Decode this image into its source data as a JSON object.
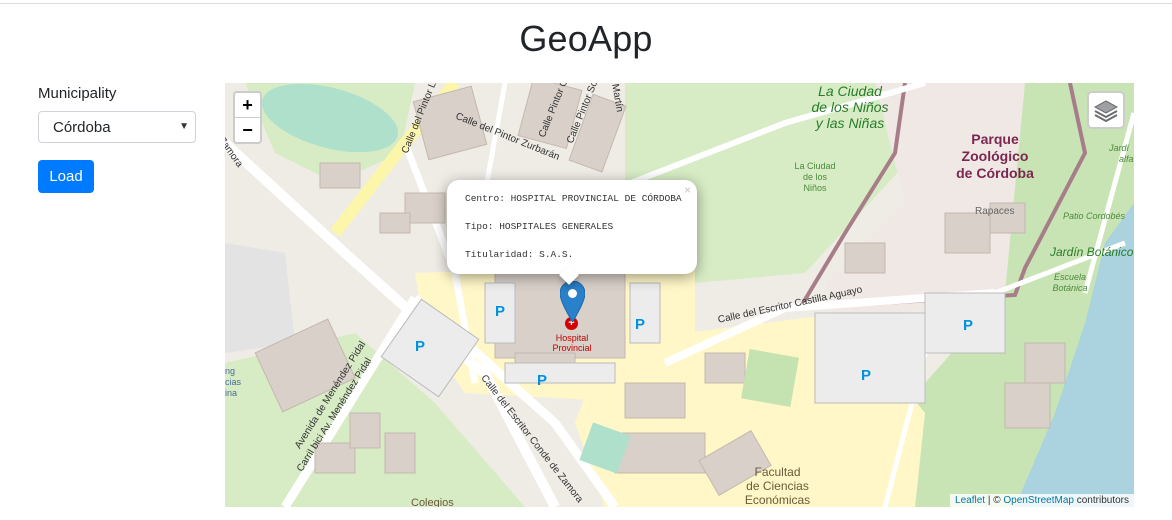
{
  "app": {
    "title": "GeoApp"
  },
  "sidebar": {
    "municipality_label": "Municipality",
    "municipality_value": "Córdoba",
    "load_label": "Load"
  },
  "map": {
    "controls": {
      "zoom_in": "+",
      "zoom_out": "−",
      "layers_icon": "layers-icon"
    },
    "popup": {
      "centro": "Centro: HOSPITAL PROVINCIAL DE CÓRDOBA",
      "tipo": "Tipo: HOSPITALES GENERALES",
      "titularidad": "Titularidad: S.A.S.",
      "close": "×"
    },
    "marker_icon": "map-pin-icon",
    "labels": {
      "parque1": "Parque",
      "parque2": "Zoológico",
      "parque3": "de Córdoba",
      "ciudad1": "La Ciudad",
      "ciudad2": "de los Niños",
      "ciudad3": "y las Niñas",
      "ciudad_small1": "La Ciudad",
      "ciudad_small2": "de los",
      "ciudad_small3": "Niños",
      "rapaces": "Rapaces",
      "patio": "Patio Cordobés",
      "jardin": "Jardín Botánico",
      "escuela1": "Escuela",
      "escuela2": "Botánica",
      "jardin_small": "Jardí",
      "alfa": "alfa",
      "hospital1": "Hospital",
      "hospital2": "Provincial",
      "facultad1": "Facultad",
      "facultad2": "de Ciencias",
      "facultad3": "Económicas",
      "colegios": "Colegios",
      "street_pintor_zurbaran": "Calle del Pintor Zurbarán",
      "street_pintor_l": "Calle del Pintor L",
      "street_pintor_so": "Calle Pintor So",
      "street_pintor_g": "Calle Pintor G",
      "street_martin": "Martín",
      "street_castilla": "Calle del Escritor Castilla Aguayo",
      "street_conde": "Calle del Escritor Conde de Zamora",
      "street_menendez": "Avenida de Menéndez Pidal",
      "street_carril": "Carril bici Av. Menéndez Pidal",
      "street_zamora": "Zamora",
      "parking": "P",
      "ciencias1": "ng",
      "ciencias2": "cias",
      "ciencias3": "ina"
    },
    "attribution": {
      "leaflet": "Leaflet",
      "sep": " | © ",
      "osm": "OpenStreetMap",
      "contrib": " contributors"
    }
  }
}
